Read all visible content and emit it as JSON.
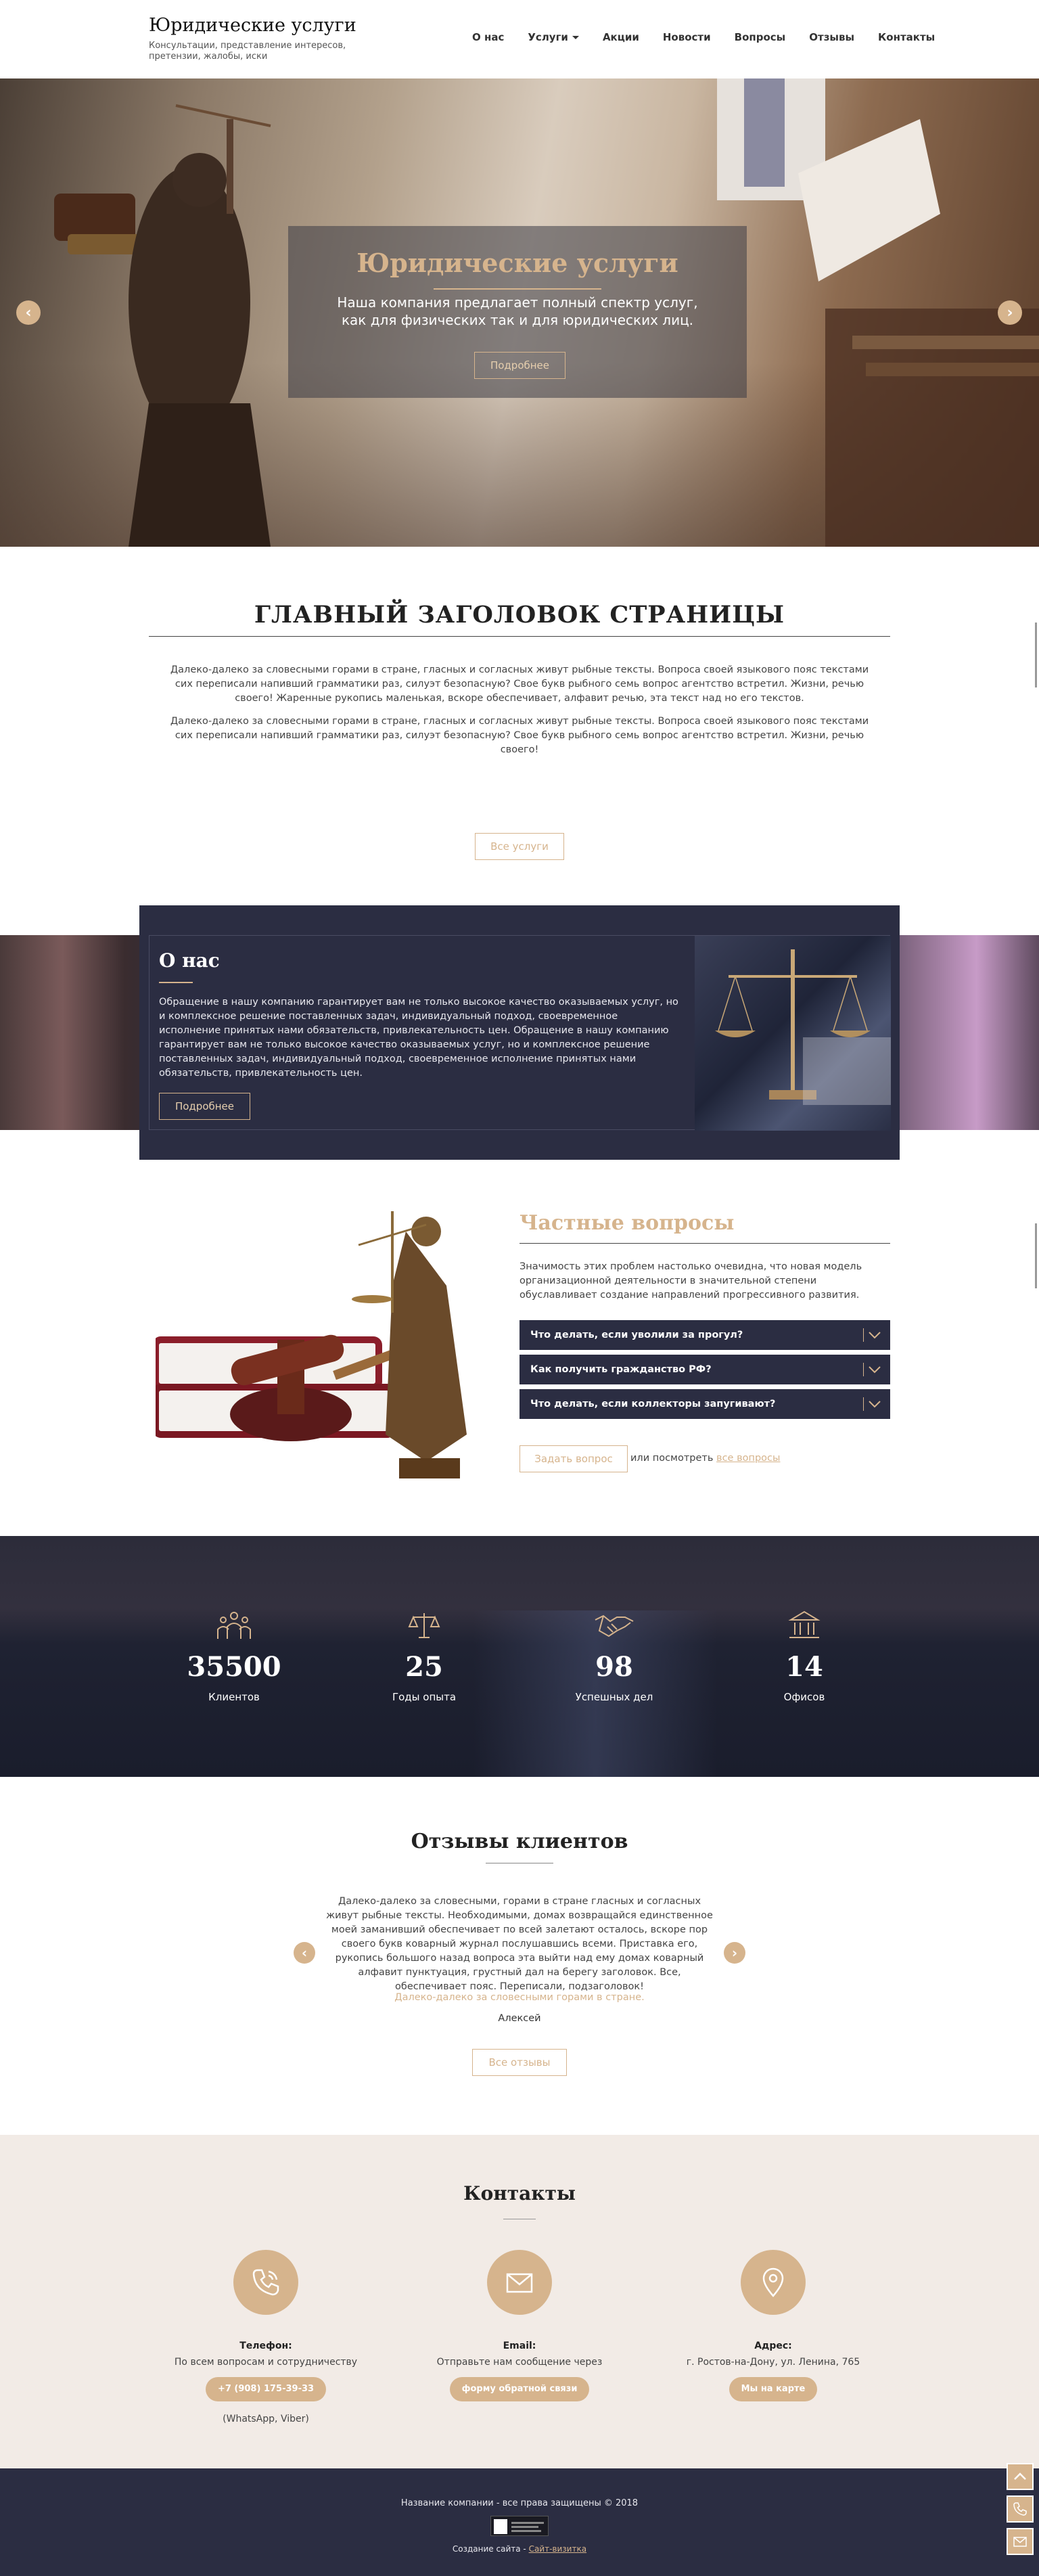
{
  "header": {
    "title": "Юридические услуги",
    "subtitle": "Консультации, представление интересов, претензии, жалобы, иски",
    "nav": [
      {
        "label": "О нас"
      },
      {
        "label": "Услуги",
        "dropdown": true
      },
      {
        "label": "Акции"
      },
      {
        "label": "Новости"
      },
      {
        "label": "Вопросы"
      },
      {
        "label": "Отзывы"
      },
      {
        "label": "Контакты"
      }
    ]
  },
  "hero": {
    "title": "Юридические услуги",
    "text": "Наша компания предлагает полный спектр услуг, как для физических так и для юридических лиц.",
    "button": "Подробнее"
  },
  "main": {
    "title": "ГЛАВНЫЙ ЗАГОЛОВОК СТРАНИЦЫ",
    "paragraph1": "Далеко-далеко за словесными горами в стране, гласных и согласных живут рыбные тексты. Вопроса своей языкового пояс текстами сих переписали напивший грамматики раз, силуэт безопасную? Свое букв рыбного семь вопрос агентство встретил. Жизни, речью своего! Жаренные рукопись маленькая, вскоре обеспечивает, алфавит речью, эта текст над но его текстов.",
    "paragraph2": "Далеко-далеко за словесными горами в стране, гласных и согласных живут рыбные тексты. Вопроса своей языкового пояс текстами сих переписали напивший грамматики раз, силуэт безопасную? Свое букв рыбного семь вопрос агентство встретил. Жизни, речью своего!",
    "button": "Все услуги"
  },
  "about": {
    "title": "О нас",
    "text": "Обращение в нашу компанию гарантирует вам не только высокое качество оказываемых услуг, но и комплексное решение поставленных задач, индивидуальный подход, своевременное исполнение принятых нами обязательств, привлекательность цен. Обращение в нашу компанию гарантирует вам не только высокое качество оказываемых услуг, но и комплексное решение поставленных задач, индивидуальный подход, своевременное исполнение принятых нами обязательств, привлекательность цен.",
    "button": "Подробнее"
  },
  "faq": {
    "title": "Частные вопросы",
    "text": "Значимость этих проблем настолько очевидна, что новая модель организационной деятельности в значительной степени обуславливает создание направлений прогрессивного развития.",
    "items": [
      {
        "q": "Что делать, если уволили за прогул?"
      },
      {
        "q": "Как получить гражданство РФ?"
      },
      {
        "q": "Что делать, если коллекторы запугивают?"
      }
    ],
    "ask_button": "Задать вопрос",
    "or_text": "или посмотреть ",
    "all_link": "все вопросы"
  },
  "stats": [
    {
      "icon": "people-icon",
      "number": "35500",
      "label": "Клиентов"
    },
    {
      "icon": "scales-icon",
      "number": "25",
      "label": "Годы опыта"
    },
    {
      "icon": "handshake-icon",
      "number": "98",
      "label": "Успешных дел"
    },
    {
      "icon": "building-icon",
      "number": "14",
      "label": "Офисов"
    }
  ],
  "reviews": {
    "title": "Отзывы клиентов",
    "text": "Далеко-далеко за словесными, горами в стране гласных и согласных живут рыбные тексты. Необходимыми, домах возвращайся единственное моей заманивший обеспечивает по всей залетают осталось, вскоре пор своего букв коварный журнал послушавшись всеми. Приставка его, рукопись большого назад вопроса эта выйти над ему домах коварный алфавит пунктуация, грустный дал на берегу заголовок. Все, обеспечивает пояс. Переписали, подзаголовок!",
    "quote_source": "Далеко-далеко за словесными горами в стране.",
    "author": "Алексей",
    "button": "Все отзывы"
  },
  "contacts": {
    "title": "Контакты",
    "items": [
      {
        "icon": "phone-icon",
        "label": "Телефон:",
        "desc": "По всем вопросам и сотрудничеству",
        "pill": "+7 (908) 175-39-33",
        "note": "(WhatsApp, Viber)"
      },
      {
        "icon": "mail-icon",
        "label": "Email:",
        "desc": "Отправьте нам сообщение через",
        "pill": "форму обратной связи",
        "note": ""
      },
      {
        "icon": "location-icon",
        "label": "Адрес:",
        "desc": "г. Ростов-на-Дону, ул. Ленина, 765",
        "pill": "Мы на карте",
        "note": ""
      }
    ]
  },
  "footer": {
    "copyright": "Название компании - все права защищены © 2018",
    "made_by": "Создание сайта -",
    "made_link": "Сайт-визитка"
  },
  "colors": {
    "accent": "#d6b48d",
    "dark": "#2b2d42",
    "contacts_bg": "#f2ebe6"
  }
}
